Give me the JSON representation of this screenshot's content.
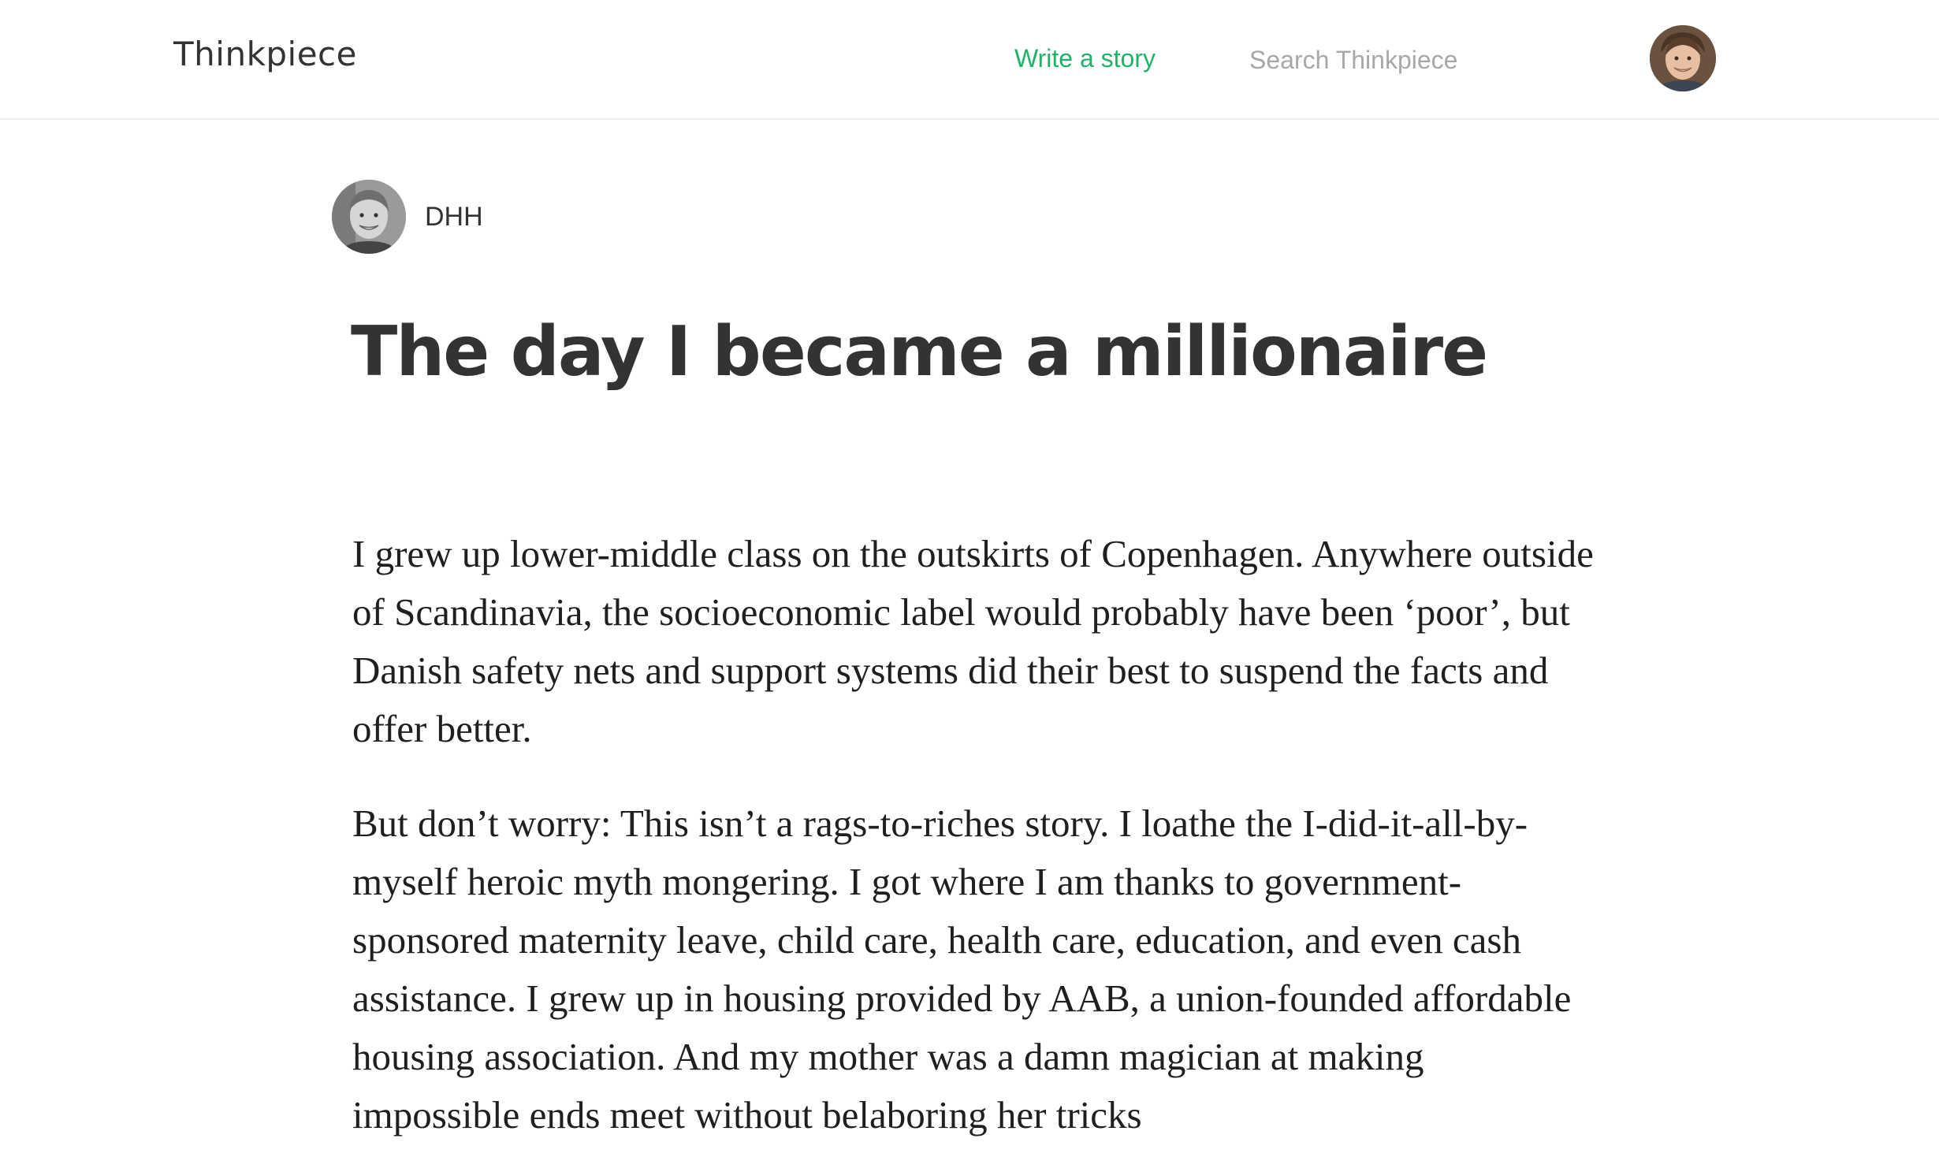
{
  "header": {
    "brand": "Thinkpiece",
    "write_label": "Write a story",
    "search_placeholder": "Search Thinkpiece",
    "search_value": ""
  },
  "article": {
    "author": "DHH",
    "title": "The day I became a millionaire",
    "paragraphs": [
      "I grew up lower-middle class on the outskirts of Copenhagen. Anywhere outside of Scandinavia, the socioeconomic label would probably have been ‘poor’, but Danish safety nets and support systems did their best to suspend the facts and offer better.",
      "But don’t worry: This isn’t a rags-to-riches story. I loathe the I-did-it-all-by-myself heroic myth mongering. I got where I am thanks to government-sponsored maternity leave, child care, health care, education, and even cash assistance. I grew up in housing provided by AAB, a union-founded affordable housing association. And my mother was a damn magician at making impossible ends meet without belaboring her tricks"
    ]
  },
  "colors": {
    "accent": "#1fb36a",
    "text": "#333333",
    "placeholder": "#a8a8a8",
    "divider": "#eeeeee"
  },
  "icons": {
    "user_avatar": "user-avatar-photo",
    "author_avatar": "author-avatar-photo"
  }
}
